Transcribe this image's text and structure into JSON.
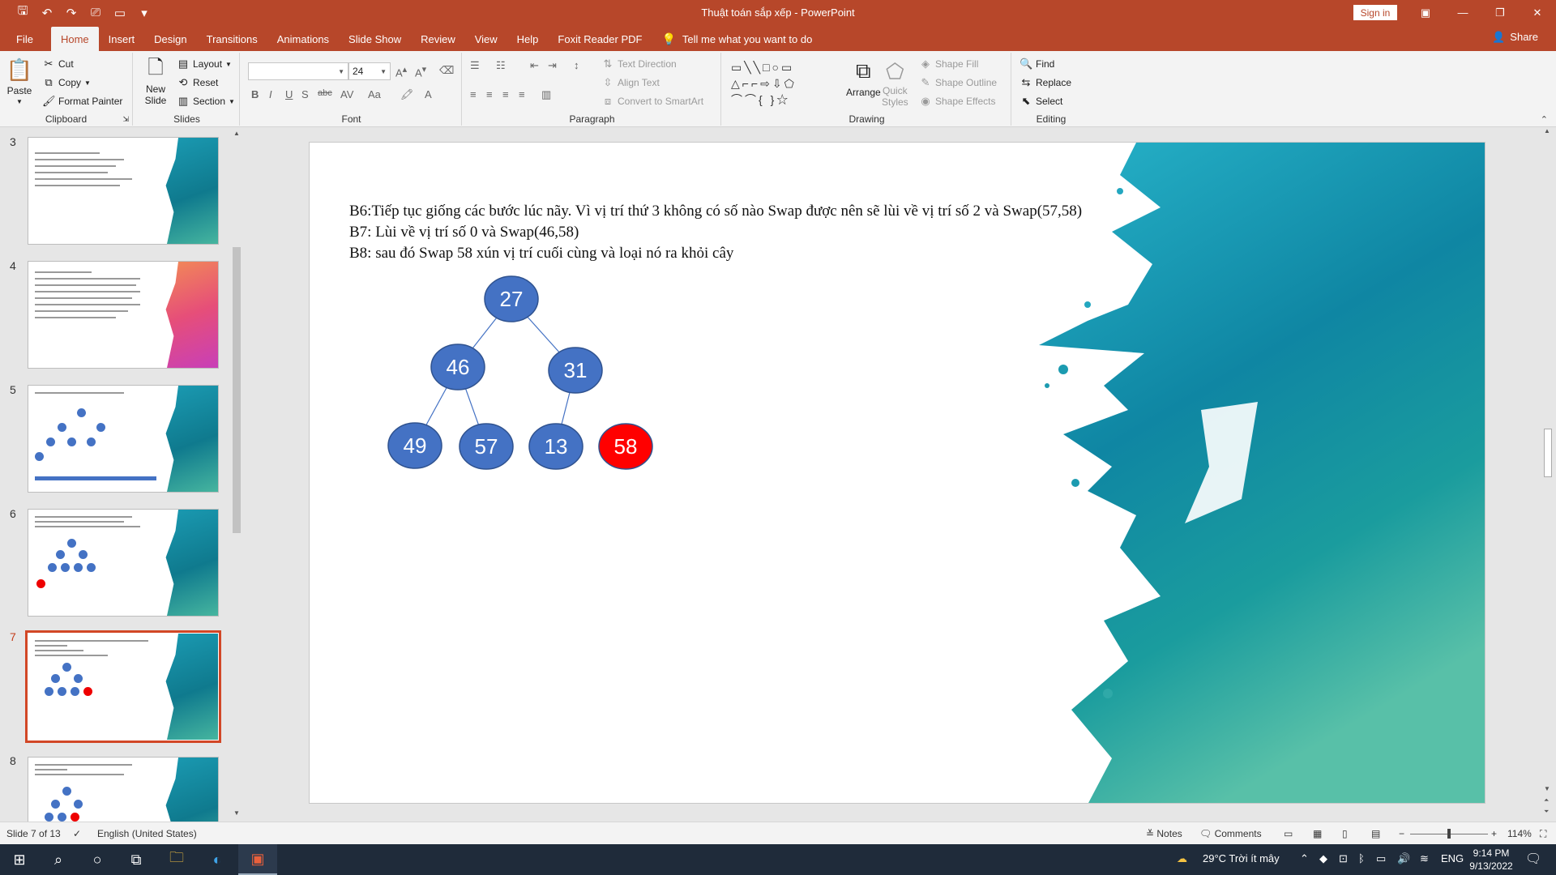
{
  "window": {
    "title": "Thuật toán sắp xếp  -  PowerPoint",
    "sign_in": "Sign in"
  },
  "tabs": [
    "File",
    "Home",
    "Insert",
    "Design",
    "Transitions",
    "Animations",
    "Slide Show",
    "Review",
    "View",
    "Help",
    "Foxit Reader PDF"
  ],
  "tell_me": "Tell me what you want to do",
  "share": "Share",
  "ribbon": {
    "clipboard": {
      "label": "Clipboard",
      "paste": "Paste",
      "cut": "Cut",
      "copy": "Copy",
      "format_painter": "Format Painter"
    },
    "slides": {
      "label": "Slides",
      "new_slide_1": "New",
      "new_slide_2": "Slide",
      "layout": "Layout",
      "reset": "Reset",
      "section": "Section"
    },
    "font": {
      "label": "Font",
      "font_name": "",
      "font_size": "24"
    },
    "paragraph": {
      "label": "Paragraph",
      "text_direction": "Text Direction",
      "align_text": "Align Text",
      "convert_smartart": "Convert to SmartArt"
    },
    "drawing": {
      "label": "Drawing",
      "arrange": "Arrange",
      "quick_styles_1": "Quick",
      "quick_styles_2": "Styles",
      "shape_fill": "Shape Fill",
      "shape_outline": "Shape Outline",
      "shape_effects": "Shape Effects"
    },
    "editing": {
      "label": "Editing",
      "find": "Find",
      "replace": "Replace",
      "select": "Select"
    }
  },
  "thumbnails": [
    {
      "number": "3",
      "style": "teal"
    },
    {
      "number": "4",
      "style": "pink"
    },
    {
      "number": "5",
      "style": "teal"
    },
    {
      "number": "6",
      "style": "teal"
    },
    {
      "number": "7",
      "style": "teal",
      "selected": true
    },
    {
      "number": "8",
      "style": "teal"
    }
  ],
  "slide": {
    "lines": [
      "B6:Tiếp tục giống các bước lúc nãy. Vì vị trí thứ 3 không có số nào Swap được nên sẽ lùi về vị trí số 2 và Swap(57,58)",
      "B7: Lùi về vị trí số 0 và Swap(46,58)",
      "B8: sau đó Swap 58 xún vị trí cuối cùng và loại nó ra khỏi cây"
    ],
    "tree": {
      "nodes": [
        {
          "id": "n27",
          "value": "27",
          "color": "#4472c4"
        },
        {
          "id": "n46",
          "value": "46",
          "color": "#4472c4"
        },
        {
          "id": "n31",
          "value": "31",
          "color": "#4472c4"
        },
        {
          "id": "n49",
          "value": "49",
          "color": "#4472c4"
        },
        {
          "id": "n57",
          "value": "57",
          "color": "#4472c4"
        },
        {
          "id": "n13",
          "value": "13",
          "color": "#4472c4"
        },
        {
          "id": "n58",
          "value": "58",
          "color": "#ff0000"
        }
      ],
      "edges": [
        [
          "n27",
          "n46"
        ],
        [
          "n27",
          "n31"
        ],
        [
          "n46",
          "n49"
        ],
        [
          "n46",
          "n57"
        ],
        [
          "n31",
          "n13"
        ]
      ]
    }
  },
  "status": {
    "slide_of": "Slide 7 of 13",
    "language": "English (United States)",
    "notes": "Notes",
    "comments": "Comments",
    "zoom": "114%"
  },
  "taskbar": {
    "weather": "29°C  Trời ít mây",
    "lang": "ENG",
    "time": "9:14 PM",
    "date": "9/13/2022"
  },
  "colors": {
    "accent": "#b7472a",
    "node_blue": "#4472c4",
    "node_red": "#ff0000"
  }
}
